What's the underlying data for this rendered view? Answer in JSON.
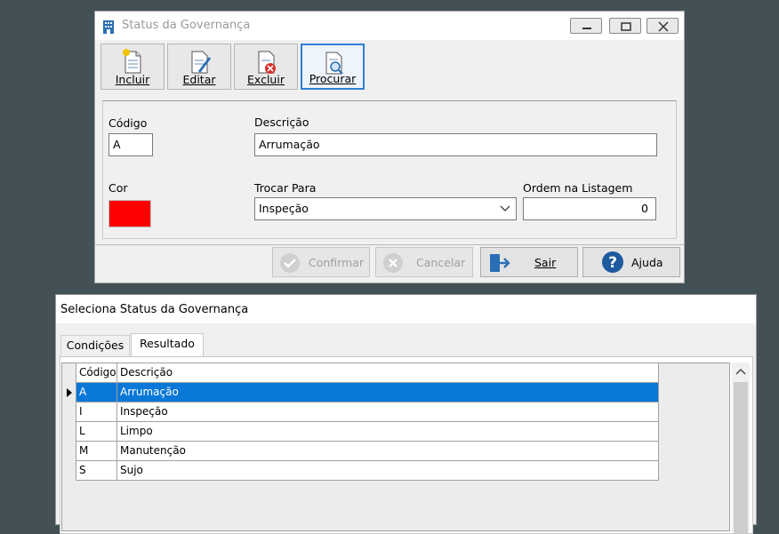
{
  "status_window": {
    "title": "Status da Governança",
    "toolbar": {
      "incluir": "Incluir",
      "editar": "Editar",
      "excluir": "Excluir",
      "procurar": "Procurar"
    },
    "form": {
      "codigo_label": "Código",
      "codigo_value": "A",
      "descricao_label": "Descrição",
      "descricao_value": "Arrumação",
      "cor_label": "Cor",
      "cor_value": "#ff0000",
      "trocar_label": "Trocar Para",
      "trocar_value": "Inspeção",
      "ordem_label": "Ordem na Listagem",
      "ordem_value": "0"
    },
    "buttons": {
      "confirmar": "Confirmar",
      "cancelar": "Cancelar",
      "sair": "Sair",
      "ajuda": "Ajuda"
    }
  },
  "select_window": {
    "title": "Seleciona Status da Governança",
    "tabs": [
      "Condições",
      "Resultado"
    ],
    "active_tab": "Resultado",
    "grid": {
      "headers": [
        "Código",
        "Descrição"
      ],
      "rows": [
        {
          "codigo": "A",
          "descricao": "Arrumação",
          "selected": true
        },
        {
          "codigo": "I",
          "descricao": "Inspeção",
          "selected": false
        },
        {
          "codigo": "L",
          "descricao": "Limpo",
          "selected": false
        },
        {
          "codigo": "M",
          "descricao": "Manutenção",
          "selected": false
        },
        {
          "codigo": "S",
          "descricao": "Sujo",
          "selected": false
        }
      ]
    }
  },
  "colors": {
    "desktop": "#435156",
    "selection": "#0a78d7",
    "swatch": "#ff0000"
  }
}
